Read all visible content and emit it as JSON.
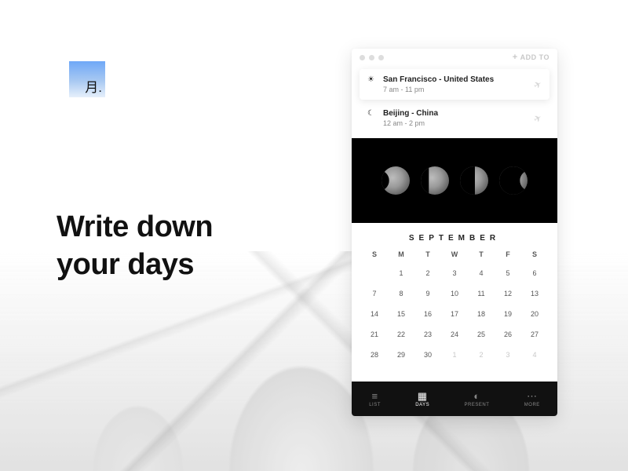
{
  "logo": {
    "text": "月."
  },
  "headline": {
    "line1": "Write down",
    "line2": "your days"
  },
  "titlebar": {
    "add_label": "ADD TO"
  },
  "locations": [
    {
      "icon": "☀",
      "name": "San Francisco - United States",
      "time": "7 am - 11 pm"
    },
    {
      "icon": "☾",
      "name": "Beijing - China",
      "time": "12 am - 2 pm"
    }
  ],
  "calendar": {
    "month": "SEPTEMBER",
    "dow": [
      "S",
      "M",
      "T",
      "W",
      "T",
      "F",
      "S"
    ],
    "weeks": [
      [
        "",
        "1",
        "2",
        "3",
        "4",
        "5",
        "6"
      ],
      [
        "7",
        "8",
        "9",
        "10",
        "11",
        "12",
        "13"
      ],
      [
        "14",
        "15",
        "16",
        "17",
        "18",
        "19",
        "20"
      ],
      [
        "21",
        "22",
        "23",
        "24",
        "25",
        "26",
        "27"
      ],
      [
        "28",
        "29",
        "30",
        "1",
        "2",
        "3",
        "4"
      ]
    ],
    "dim_last_row_from": 3
  },
  "tabs": [
    {
      "icon": "≡",
      "label": "LIST"
    },
    {
      "icon": "▦",
      "label": "DAYS",
      "active": true
    },
    {
      "icon": "◐",
      "label": "PRESENT"
    },
    {
      "icon": "⋯",
      "label": "MORE"
    }
  ]
}
